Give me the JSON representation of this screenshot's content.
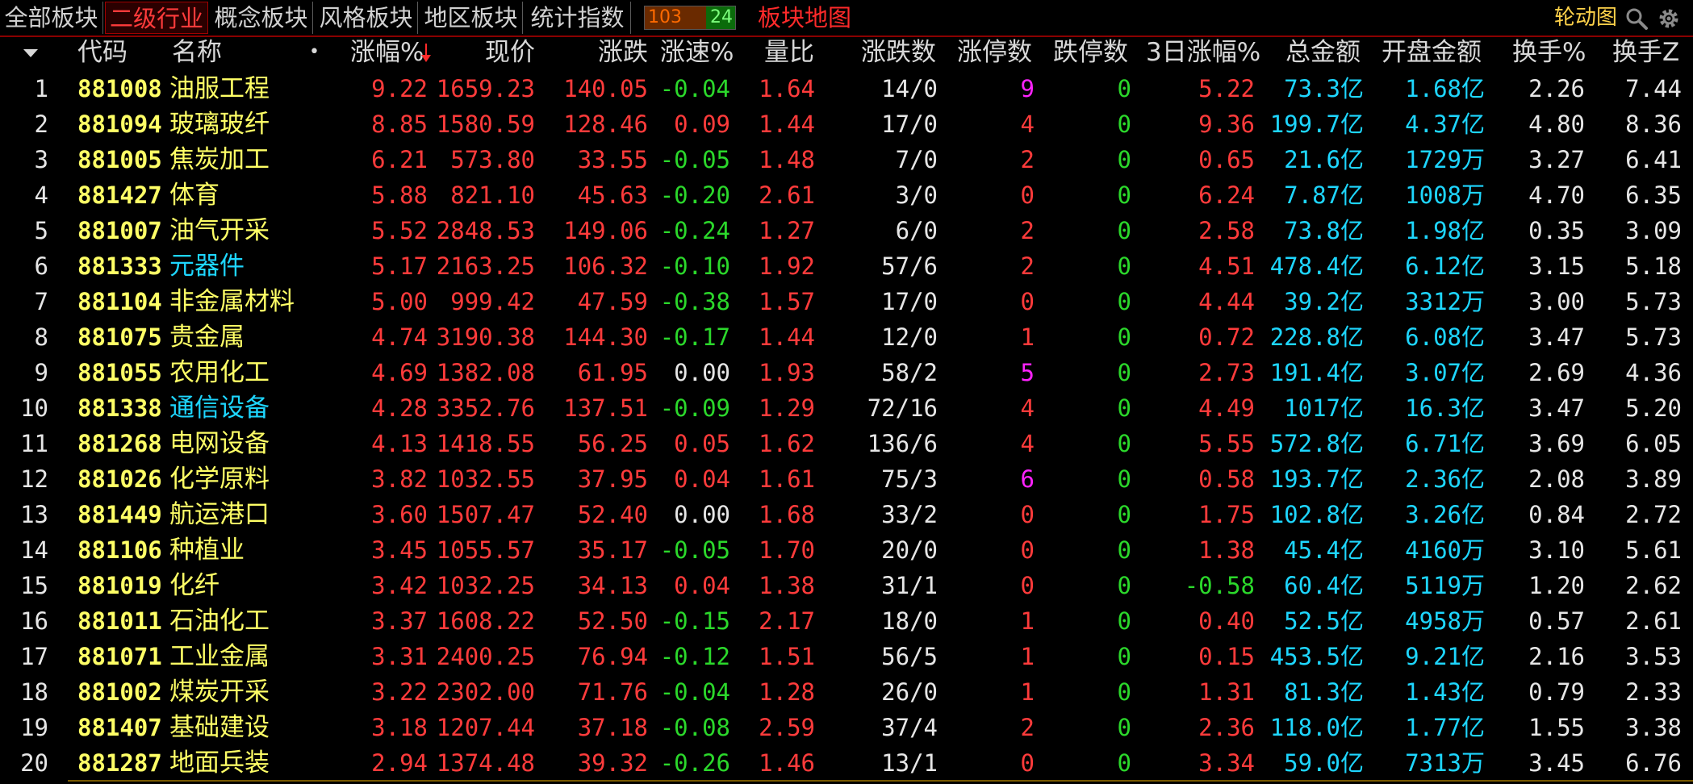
{
  "tabs": [
    {
      "label": "全部板块",
      "active": false
    },
    {
      "label": "二级行业",
      "active": true
    },
    {
      "label": "概念板块",
      "active": false
    },
    {
      "label": "风格板块",
      "active": false
    },
    {
      "label": "地区板块",
      "active": false
    },
    {
      "label": "统计指数",
      "active": false
    }
  ],
  "counter": {
    "up": "103",
    "down": "24"
  },
  "map_label": "板块地图",
  "rotate_label": "轮动图",
  "icons": {
    "search": "search-icon",
    "settings": "gear-icon",
    "sort_menu": "sort-dropdown-icon",
    "sort_arrow": "sort-desc-arrow-icon"
  },
  "colors": {
    "up": "#ff3b3b",
    "down": "#2bd82b",
    "code": "#ffff66",
    "amount": "#1ed6ff",
    "highlight_count": "#ff22ff"
  },
  "columns": [
    "代码",
    "名称",
    "•",
    "涨幅%",
    "现价",
    "涨跌",
    "涨速%",
    "量比",
    "涨跌数",
    "涨停数",
    "跌停数",
    "3日涨幅%",
    "总金额",
    "开盘金额",
    "换手%",
    "换手Z"
  ],
  "rows": [
    {
      "idx": "1",
      "code": "881008",
      "name": "油服工程",
      "name_color": "yellow",
      "pct": "9.22",
      "price": "1659.23",
      "chg": "140.05",
      "speed": "-0.04",
      "vr": "1.64",
      "ud": "14/0",
      "limit_up": "9",
      "lu_color": "magenta",
      "limit_down": "0",
      "d3": "5.22",
      "amount": "73.3亿",
      "open_amt": "1.68亿",
      "turnover": "2.26",
      "turnz": "7.44"
    },
    {
      "idx": "2",
      "code": "881094",
      "name": "玻璃玻纤",
      "name_color": "yellow",
      "pct": "8.85",
      "price": "1580.59",
      "chg": "128.46",
      "speed": "0.09",
      "vr": "1.44",
      "ud": "17/0",
      "limit_up": "4",
      "lu_color": "red",
      "limit_down": "0",
      "d3": "9.36",
      "amount": "199.7亿",
      "open_amt": "4.37亿",
      "turnover": "4.80",
      "turnz": "8.36"
    },
    {
      "idx": "3",
      "code": "881005",
      "name": "焦炭加工",
      "name_color": "yellow",
      "pct": "6.21",
      "price": "573.80",
      "chg": "33.55",
      "speed": "-0.05",
      "vr": "1.48",
      "ud": "7/0",
      "limit_up": "2",
      "lu_color": "red",
      "limit_down": "0",
      "d3": "0.65",
      "amount": "21.6亿",
      "open_amt": "1729万",
      "turnover": "3.27",
      "turnz": "6.41"
    },
    {
      "idx": "4",
      "code": "881427",
      "name": "体育",
      "name_color": "yellow",
      "pct": "5.88",
      "price": "821.10",
      "chg": "45.63",
      "speed": "-0.20",
      "vr": "2.61",
      "ud": "3/0",
      "limit_up": "0",
      "lu_color": "red",
      "limit_down": "0",
      "d3": "6.24",
      "amount": "7.87亿",
      "open_amt": "1008万",
      "turnover": "4.70",
      "turnz": "6.35"
    },
    {
      "idx": "5",
      "code": "881007",
      "name": "油气开采",
      "name_color": "yellow",
      "pct": "5.52",
      "price": "2848.53",
      "chg": "149.06",
      "speed": "-0.24",
      "vr": "1.27",
      "ud": "6/0",
      "limit_up": "2",
      "lu_color": "red",
      "limit_down": "0",
      "d3": "2.58",
      "amount": "73.8亿",
      "open_amt": "1.98亿",
      "turnover": "0.35",
      "turnz": "3.09"
    },
    {
      "idx": "6",
      "code": "881333",
      "name": "元器件",
      "name_color": "cyan",
      "pct": "5.17",
      "price": "2163.25",
      "chg": "106.32",
      "speed": "-0.10",
      "vr": "1.92",
      "ud": "57/6",
      "limit_up": "2",
      "lu_color": "red",
      "limit_down": "0",
      "d3": "4.51",
      "amount": "478.4亿",
      "open_amt": "6.12亿",
      "turnover": "3.15",
      "turnz": "5.18"
    },
    {
      "idx": "7",
      "code": "881104",
      "name": "非金属材料",
      "name_color": "yellow",
      "pct": "5.00",
      "price": "999.42",
      "chg": "47.59",
      "speed": "-0.38",
      "vr": "1.57",
      "ud": "17/0",
      "limit_up": "0",
      "lu_color": "red",
      "limit_down": "0",
      "d3": "4.44",
      "amount": "39.2亿",
      "open_amt": "3312万",
      "turnover": "3.00",
      "turnz": "5.73"
    },
    {
      "idx": "8",
      "code": "881075",
      "name": "贵金属",
      "name_color": "yellow",
      "pct": "4.74",
      "price": "3190.38",
      "chg": "144.30",
      "speed": "-0.17",
      "vr": "1.44",
      "ud": "12/0",
      "limit_up": "1",
      "lu_color": "red",
      "limit_down": "0",
      "d3": "0.72",
      "amount": "228.8亿",
      "open_amt": "6.08亿",
      "turnover": "3.47",
      "turnz": "5.73"
    },
    {
      "idx": "9",
      "code": "881055",
      "name": "农用化工",
      "name_color": "yellow",
      "pct": "4.69",
      "price": "1382.08",
      "chg": "61.95",
      "speed": "0.00",
      "vr": "1.93",
      "ud": "58/2",
      "limit_up": "5",
      "lu_color": "magenta",
      "limit_down": "0",
      "d3": "2.73",
      "amount": "191.4亿",
      "open_amt": "3.07亿",
      "turnover": "2.69",
      "turnz": "4.36"
    },
    {
      "idx": "10",
      "code": "881338",
      "name": "通信设备",
      "name_color": "cyan",
      "pct": "4.28",
      "price": "3352.76",
      "chg": "137.51",
      "speed": "-0.09",
      "vr": "1.29",
      "ud": "72/16",
      "limit_up": "4",
      "lu_color": "red",
      "limit_down": "0",
      "d3": "4.49",
      "amount": "1017亿",
      "open_amt": "16.3亿",
      "turnover": "3.47",
      "turnz": "5.20"
    },
    {
      "idx": "11",
      "code": "881268",
      "name": "电网设备",
      "name_color": "yellow",
      "pct": "4.13",
      "price": "1418.55",
      "chg": "56.25",
      "speed": "0.05",
      "vr": "1.62",
      "ud": "136/6",
      "limit_up": "4",
      "lu_color": "red",
      "limit_down": "0",
      "d3": "5.55",
      "amount": "572.8亿",
      "open_amt": "6.71亿",
      "turnover": "3.69",
      "turnz": "6.05"
    },
    {
      "idx": "12",
      "code": "881026",
      "name": "化学原料",
      "name_color": "yellow",
      "pct": "3.82",
      "price": "1032.55",
      "chg": "37.95",
      "speed": "0.04",
      "vr": "1.61",
      "ud": "75/3",
      "limit_up": "6",
      "lu_color": "magenta",
      "limit_down": "0",
      "d3": "0.58",
      "amount": "193.7亿",
      "open_amt": "2.36亿",
      "turnover": "2.08",
      "turnz": "3.89"
    },
    {
      "idx": "13",
      "code": "881449",
      "name": "航运港口",
      "name_color": "yellow",
      "pct": "3.60",
      "price": "1507.47",
      "chg": "52.40",
      "speed": "0.00",
      "vr": "1.68",
      "ud": "33/2",
      "limit_up": "0",
      "lu_color": "red",
      "limit_down": "0",
      "d3": "1.75",
      "amount": "102.8亿",
      "open_amt": "3.26亿",
      "turnover": "0.84",
      "turnz": "2.72"
    },
    {
      "idx": "14",
      "code": "881106",
      "name": "种植业",
      "name_color": "yellow",
      "pct": "3.45",
      "price": "1055.57",
      "chg": "35.17",
      "speed": "-0.05",
      "vr": "1.70",
      "ud": "20/0",
      "limit_up": "0",
      "lu_color": "red",
      "limit_down": "0",
      "d3": "1.38",
      "amount": "45.4亿",
      "open_amt": "4160万",
      "turnover": "3.10",
      "turnz": "5.61"
    },
    {
      "idx": "15",
      "code": "881019",
      "name": "化纤",
      "name_color": "yellow",
      "pct": "3.42",
      "price": "1032.25",
      "chg": "34.13",
      "speed": "0.04",
      "vr": "1.38",
      "ud": "31/1",
      "limit_up": "0",
      "lu_color": "red",
      "limit_down": "0",
      "d3": "-0.58",
      "amount": "60.4亿",
      "open_amt": "5119万",
      "turnover": "1.20",
      "turnz": "2.62"
    },
    {
      "idx": "16",
      "code": "881011",
      "name": "石油化工",
      "name_color": "yellow",
      "pct": "3.37",
      "price": "1608.22",
      "chg": "52.50",
      "speed": "-0.15",
      "vr": "2.17",
      "ud": "18/0",
      "limit_up": "1",
      "lu_color": "red",
      "limit_down": "0",
      "d3": "0.40",
      "amount": "52.5亿",
      "open_amt": "4958万",
      "turnover": "0.57",
      "turnz": "2.61"
    },
    {
      "idx": "17",
      "code": "881071",
      "name": "工业金属",
      "name_color": "yellow",
      "pct": "3.31",
      "price": "2400.25",
      "chg": "76.94",
      "speed": "-0.12",
      "vr": "1.51",
      "ud": "56/5",
      "limit_up": "1",
      "lu_color": "red",
      "limit_down": "0",
      "d3": "0.15",
      "amount": "453.5亿",
      "open_amt": "9.21亿",
      "turnover": "2.16",
      "turnz": "3.53"
    },
    {
      "idx": "18",
      "code": "881002",
      "name": "煤炭开采",
      "name_color": "yellow",
      "pct": "3.22",
      "price": "2302.00",
      "chg": "71.76",
      "speed": "-0.04",
      "vr": "1.28",
      "ud": "26/0",
      "limit_up": "1",
      "lu_color": "red",
      "limit_down": "0",
      "d3": "1.31",
      "amount": "81.3亿",
      "open_amt": "1.43亿",
      "turnover": "0.79",
      "turnz": "2.33"
    },
    {
      "idx": "19",
      "code": "881407",
      "name": "基础建设",
      "name_color": "yellow",
      "pct": "3.18",
      "price": "1207.44",
      "chg": "37.18",
      "speed": "-0.08",
      "vr": "2.59",
      "ud": "37/4",
      "limit_up": "2",
      "lu_color": "red",
      "limit_down": "0",
      "d3": "2.36",
      "amount": "118.0亿",
      "open_amt": "1.77亿",
      "turnover": "1.55",
      "turnz": "3.38"
    },
    {
      "idx": "20",
      "code": "881287",
      "name": "地面兵装",
      "name_color": "yellow",
      "pct": "2.94",
      "price": "1374.48",
      "chg": "39.32",
      "speed": "-0.26",
      "vr": "1.46",
      "ud": "13/1",
      "limit_up": "0",
      "lu_color": "red",
      "limit_down": "0",
      "d3": "3.34",
      "amount": "59.0亿",
      "open_amt": "7313万",
      "turnover": "3.45",
      "turnz": "6.76"
    }
  ]
}
